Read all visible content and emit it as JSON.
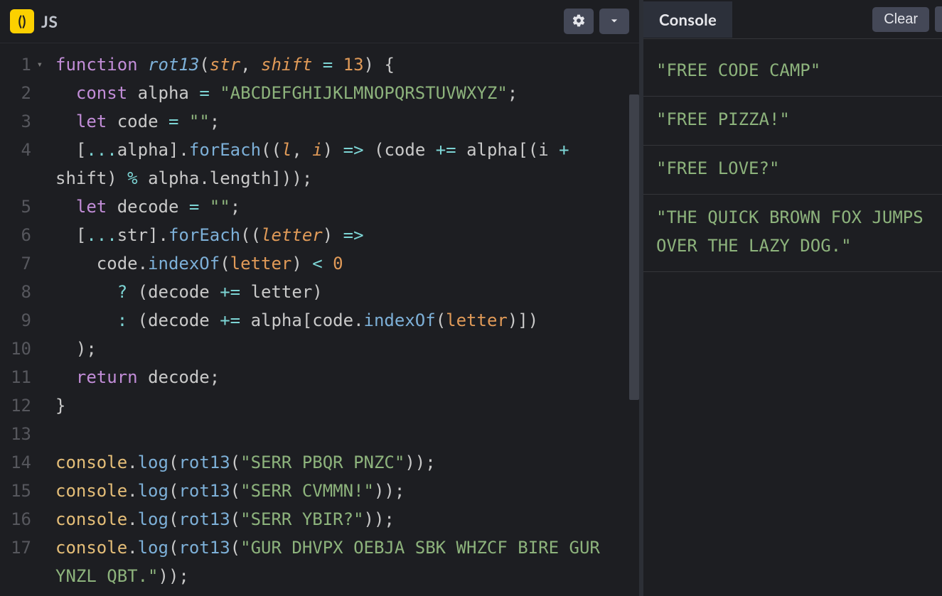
{
  "editor": {
    "language_badge": "()",
    "language_label": "JS",
    "settings_icon": "gear",
    "collapse_icon": "chevron-down",
    "line_numbers": [
      "1",
      "2",
      "3",
      "4",
      "5",
      "6",
      "7",
      "8",
      "9",
      "10",
      "11",
      "12",
      "13",
      "14",
      "15",
      "16",
      "17"
    ],
    "code_tokens": [
      [
        {
          "t": "kw",
          "v": "function"
        },
        {
          "t": "sp",
          "v": " "
        },
        {
          "t": "fnd",
          "v": "rot13"
        },
        {
          "t": "pun",
          "v": "("
        },
        {
          "t": "param",
          "v": "str"
        },
        {
          "t": "pun",
          "v": ","
        },
        {
          "t": "sp",
          "v": " "
        },
        {
          "t": "param",
          "v": "shift"
        },
        {
          "t": "sp",
          "v": " "
        },
        {
          "t": "op",
          "v": "="
        },
        {
          "t": "sp",
          "v": " "
        },
        {
          "t": "num",
          "v": "13"
        },
        {
          "t": "pun",
          "v": ")"
        },
        {
          "t": "sp",
          "v": " "
        },
        {
          "t": "pun",
          "v": "{"
        }
      ],
      [
        {
          "t": "sp",
          "v": "  "
        },
        {
          "t": "decl",
          "v": "const"
        },
        {
          "t": "sp",
          "v": " "
        },
        {
          "t": "obj",
          "v": "alpha"
        },
        {
          "t": "sp",
          "v": " "
        },
        {
          "t": "op",
          "v": "="
        },
        {
          "t": "sp",
          "v": " "
        },
        {
          "t": "str",
          "v": "\"ABCDEFGHIJKLMNOPQRSTUVWXYZ\""
        },
        {
          "t": "pun",
          "v": ";"
        }
      ],
      [
        {
          "t": "sp",
          "v": "  "
        },
        {
          "t": "decl",
          "v": "let"
        },
        {
          "t": "sp",
          "v": " "
        },
        {
          "t": "obj",
          "v": "code"
        },
        {
          "t": "sp",
          "v": " "
        },
        {
          "t": "op",
          "v": "="
        },
        {
          "t": "sp",
          "v": " "
        },
        {
          "t": "str",
          "v": "\"\""
        },
        {
          "t": "pun",
          "v": ";"
        }
      ],
      [
        {
          "t": "sp",
          "v": "  "
        },
        {
          "t": "pun",
          "v": "["
        },
        {
          "t": "op",
          "v": "..."
        },
        {
          "t": "obj",
          "v": "alpha"
        },
        {
          "t": "pun",
          "v": "]."
        },
        {
          "t": "fn",
          "v": "forEach"
        },
        {
          "t": "pun",
          "v": "(("
        },
        {
          "t": "param",
          "v": "l"
        },
        {
          "t": "pun",
          "v": ","
        },
        {
          "t": "sp",
          "v": " "
        },
        {
          "t": "param",
          "v": "i"
        },
        {
          "t": "pun",
          "v": ")"
        },
        {
          "t": "sp",
          "v": " "
        },
        {
          "t": "op",
          "v": "=>"
        },
        {
          "t": "sp",
          "v": " "
        },
        {
          "t": "pun",
          "v": "("
        },
        {
          "t": "obj",
          "v": "code"
        },
        {
          "t": "sp",
          "v": " "
        },
        {
          "t": "op",
          "v": "+="
        },
        {
          "t": "sp",
          "v": " "
        },
        {
          "t": "obj",
          "v": "alpha"
        },
        {
          "t": "pun",
          "v": "[("
        },
        {
          "t": "obj",
          "v": "i"
        },
        {
          "t": "sp",
          "v": " "
        },
        {
          "t": "op",
          "v": "+"
        },
        {
          "t": "sp",
          "v": " "
        },
        {
          "t": "obj",
          "v": "shift"
        },
        {
          "t": "pun",
          "v": ")"
        },
        {
          "t": "sp",
          "v": " "
        },
        {
          "t": "op",
          "v": "%"
        },
        {
          "t": "sp",
          "v": " "
        },
        {
          "t": "obj",
          "v": "alpha"
        },
        {
          "t": "pun",
          "v": "."
        },
        {
          "t": "obj",
          "v": "length"
        },
        {
          "t": "pun",
          "v": "]));"
        }
      ],
      [
        {
          "t": "sp",
          "v": "  "
        },
        {
          "t": "decl",
          "v": "let"
        },
        {
          "t": "sp",
          "v": " "
        },
        {
          "t": "obj",
          "v": "decode"
        },
        {
          "t": "sp",
          "v": " "
        },
        {
          "t": "op",
          "v": "="
        },
        {
          "t": "sp",
          "v": " "
        },
        {
          "t": "str",
          "v": "\"\""
        },
        {
          "t": "pun",
          "v": ";"
        }
      ],
      [
        {
          "t": "sp",
          "v": "  "
        },
        {
          "t": "pun",
          "v": "["
        },
        {
          "t": "op",
          "v": "..."
        },
        {
          "t": "obj",
          "v": "str"
        },
        {
          "t": "pun",
          "v": "]."
        },
        {
          "t": "fn",
          "v": "forEach"
        },
        {
          "t": "pun",
          "v": "(("
        },
        {
          "t": "param",
          "v": "letter"
        },
        {
          "t": "pun",
          "v": ")"
        },
        {
          "t": "sp",
          "v": " "
        },
        {
          "t": "op",
          "v": "=>"
        }
      ],
      [
        {
          "t": "sp",
          "v": "    "
        },
        {
          "t": "obj",
          "v": "code"
        },
        {
          "t": "pun",
          "v": "."
        },
        {
          "t": "fn",
          "v": "indexOf"
        },
        {
          "t": "pun",
          "v": "("
        },
        {
          "t": "arg",
          "v": "letter"
        },
        {
          "t": "pun",
          "v": ")"
        },
        {
          "t": "sp",
          "v": " "
        },
        {
          "t": "op",
          "v": "<"
        },
        {
          "t": "sp",
          "v": " "
        },
        {
          "t": "num",
          "v": "0"
        }
      ],
      [
        {
          "t": "sp",
          "v": "      "
        },
        {
          "t": "op",
          "v": "?"
        },
        {
          "t": "sp",
          "v": " "
        },
        {
          "t": "pun",
          "v": "("
        },
        {
          "t": "obj",
          "v": "decode"
        },
        {
          "t": "sp",
          "v": " "
        },
        {
          "t": "op",
          "v": "+="
        },
        {
          "t": "sp",
          "v": " "
        },
        {
          "t": "obj",
          "v": "letter"
        },
        {
          "t": "pun",
          "v": ")"
        }
      ],
      [
        {
          "t": "sp",
          "v": "      "
        },
        {
          "t": "op",
          "v": ":"
        },
        {
          "t": "sp",
          "v": " "
        },
        {
          "t": "pun",
          "v": "("
        },
        {
          "t": "obj",
          "v": "decode"
        },
        {
          "t": "sp",
          "v": " "
        },
        {
          "t": "op",
          "v": "+="
        },
        {
          "t": "sp",
          "v": " "
        },
        {
          "t": "obj",
          "v": "alpha"
        },
        {
          "t": "pun",
          "v": "["
        },
        {
          "t": "obj",
          "v": "code"
        },
        {
          "t": "pun",
          "v": "."
        },
        {
          "t": "fn",
          "v": "indexOf"
        },
        {
          "t": "pun",
          "v": "("
        },
        {
          "t": "arg",
          "v": "letter"
        },
        {
          "t": "pun",
          "v": ")])"
        }
      ],
      [
        {
          "t": "sp",
          "v": "  "
        },
        {
          "t": "pun",
          "v": ");"
        }
      ],
      [
        {
          "t": "sp",
          "v": "  "
        },
        {
          "t": "kw",
          "v": "return"
        },
        {
          "t": "sp",
          "v": " "
        },
        {
          "t": "obj",
          "v": "decode"
        },
        {
          "t": "pun",
          "v": ";"
        }
      ],
      [
        {
          "t": "pun",
          "v": "}"
        }
      ],
      [],
      [
        {
          "t": "cls",
          "v": "console"
        },
        {
          "t": "pun",
          "v": "."
        },
        {
          "t": "fn",
          "v": "log"
        },
        {
          "t": "pun",
          "v": "("
        },
        {
          "t": "fn",
          "v": "rot13"
        },
        {
          "t": "pun",
          "v": "("
        },
        {
          "t": "str",
          "v": "\"SERR PBQR PNZC\""
        },
        {
          "t": "pun",
          "v": "));"
        }
      ],
      [
        {
          "t": "cls",
          "v": "console"
        },
        {
          "t": "pun",
          "v": "."
        },
        {
          "t": "fn",
          "v": "log"
        },
        {
          "t": "pun",
          "v": "("
        },
        {
          "t": "fn",
          "v": "rot13"
        },
        {
          "t": "pun",
          "v": "("
        },
        {
          "t": "str",
          "v": "\"SERR CVMMN!\""
        },
        {
          "t": "pun",
          "v": "));"
        }
      ],
      [
        {
          "t": "cls",
          "v": "console"
        },
        {
          "t": "pun",
          "v": "."
        },
        {
          "t": "fn",
          "v": "log"
        },
        {
          "t": "pun",
          "v": "("
        },
        {
          "t": "fn",
          "v": "rot13"
        },
        {
          "t": "pun",
          "v": "("
        },
        {
          "t": "str",
          "v": "\"SERR YBIR?\""
        },
        {
          "t": "pun",
          "v": "));"
        }
      ],
      [
        {
          "t": "cls",
          "v": "console"
        },
        {
          "t": "pun",
          "v": "."
        },
        {
          "t": "fn",
          "v": "log"
        },
        {
          "t": "pun",
          "v": "("
        },
        {
          "t": "fn",
          "v": "rot13"
        },
        {
          "t": "pun",
          "v": "("
        },
        {
          "t": "str",
          "v": "\"GUR DHVPX OEBJA SBK WHZCF BIRE GUR YNZL QBT.\""
        },
        {
          "t": "pun",
          "v": "));"
        }
      ]
    ],
    "wrap_lines": {
      "3": 2,
      "16": 2
    }
  },
  "console": {
    "tab_label": "Console",
    "clear_label": "Clear",
    "output": [
      "\"FREE CODE CAMP\"",
      "\"FREE PIZZA!\"",
      "\"FREE LOVE?\"",
      "\"THE QUICK BROWN FOX JUMPS OVER THE LAZY DOG.\""
    ]
  }
}
